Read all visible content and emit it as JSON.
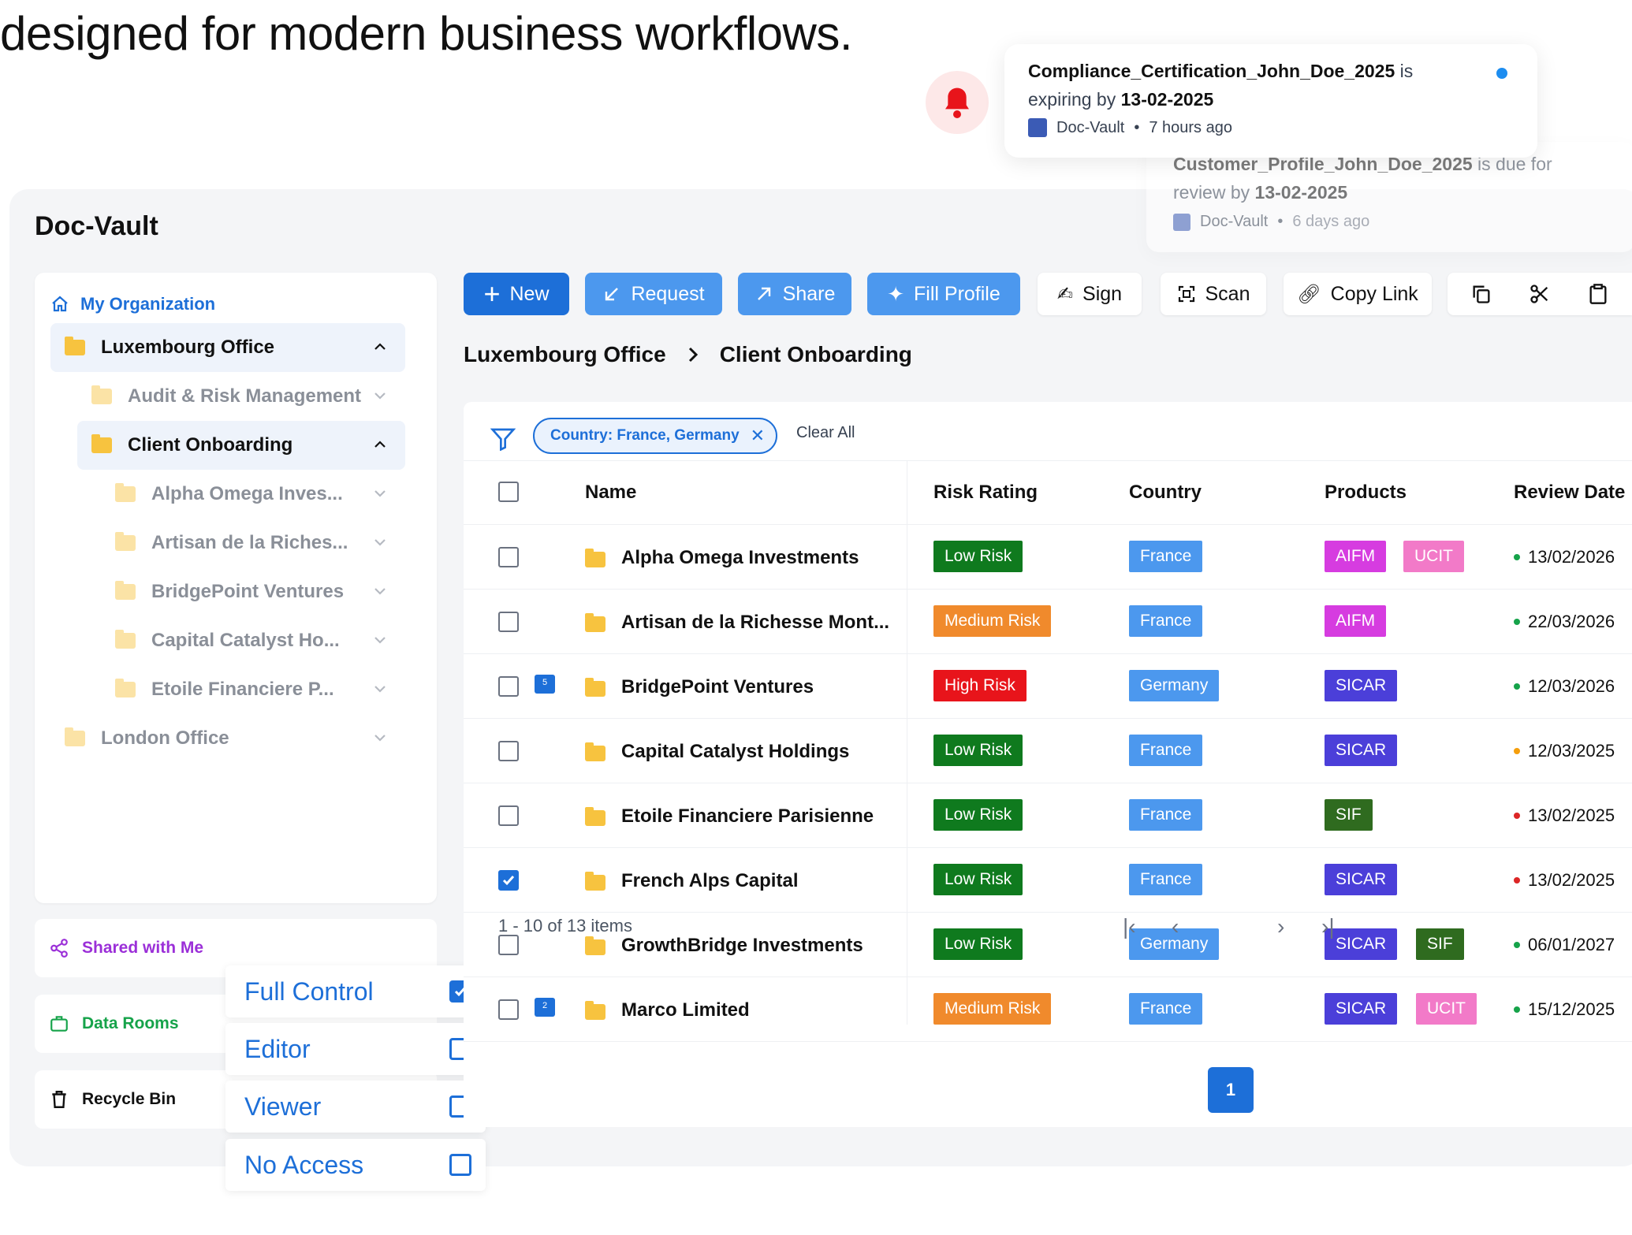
{
  "headline": "designed for modern business workflows.",
  "app": {
    "name": "Doc-Vault"
  },
  "notifications": [
    {
      "file": "Compliance_Certification_John_Doe_2025",
      "mid": " is",
      "line2": "expiring by ",
      "date": "13-02-2025",
      "source": "Doc-Vault",
      "time": "7 hours ago",
      "unread": true
    },
    {
      "file": "Customer_Profile_John_Doe_2025",
      "mid": " is due for",
      "line2": "review by ",
      "date": "13-02-2025",
      "source": "Doc-Vault",
      "time": "6 days ago",
      "unread": false
    }
  ],
  "sidebar": {
    "org": "My Organization",
    "tree": [
      {
        "label": "Luxembourg Office",
        "state": "expanded"
      },
      {
        "label": "Audit & Risk Management",
        "state": "collapsed"
      },
      {
        "label": "Client Onboarding",
        "state": "expanded"
      },
      {
        "label": "Alpha Omega Inves...",
        "state": "collapsed"
      },
      {
        "label": "Artisan de la Riches...",
        "state": "collapsed"
      },
      {
        "label": "BridgePoint Ventures",
        "state": "collapsed"
      },
      {
        "label": "Capital Catalyst Ho...",
        "state": "collapsed"
      },
      {
        "label": "Etoile Financiere P...",
        "state": "collapsed"
      },
      {
        "label": "London Office",
        "state": "collapsed"
      }
    ],
    "shared": "Shared with Me",
    "datarooms": "Data Rooms",
    "recycle": "Recycle Bin"
  },
  "permissions": [
    {
      "label": "Full Control",
      "checked": true
    },
    {
      "label": "Editor",
      "checked": false
    },
    {
      "label": "Viewer",
      "checked": false
    },
    {
      "label": "No Access",
      "checked": false
    }
  ],
  "toolbar": {
    "new": "New",
    "request": "Request",
    "share": "Share",
    "fill": "Fill Profile",
    "sign": "Sign",
    "scan": "Scan",
    "copy": "Copy Link"
  },
  "breadcrumb": [
    "Luxembourg Office",
    "Client Onboarding"
  ],
  "filter": {
    "chip": "Country: France, Germany",
    "clear": "Clear All"
  },
  "table": {
    "headers": {
      "name": "Name",
      "risk": "Risk Rating",
      "country": "Country",
      "products": "Products",
      "review": "Review Date"
    },
    "rows": [
      {
        "name": "Alpha Omega Investments",
        "risk": "Low Risk",
        "country": "France",
        "products": [
          "AIFM",
          "UCIT"
        ],
        "date": "13/02/2026",
        "status": "green",
        "checked": false,
        "comment": ""
      },
      {
        "name": "Artisan de la Richesse Mont...",
        "risk": "Medium Risk",
        "country": "France",
        "products": [
          "AIFM"
        ],
        "date": "22/03/2026",
        "status": "green",
        "checked": false,
        "comment": ""
      },
      {
        "name": "BridgePoint Ventures",
        "risk": "High Risk",
        "country": "Germany",
        "products": [
          "SICAR"
        ],
        "date": "12/03/2026",
        "status": "green",
        "checked": false,
        "comment": "5"
      },
      {
        "name": "Capital Catalyst Holdings",
        "risk": "Low Risk",
        "country": "France",
        "products": [
          "SICAR"
        ],
        "date": "12/03/2025",
        "status": "orange",
        "checked": false,
        "comment": ""
      },
      {
        "name": "Etoile Financiere Parisienne",
        "risk": "Low Risk",
        "country": "France",
        "products": [
          "SIF"
        ],
        "date": "13/02/2025",
        "status": "red",
        "checked": false,
        "comment": ""
      },
      {
        "name": "French Alps Capital",
        "risk": "Low Risk",
        "country": "France",
        "products": [
          "SICAR"
        ],
        "date": "13/02/2025",
        "status": "red",
        "checked": true,
        "comment": ""
      },
      {
        "name": "GrowthBridge Investments",
        "risk": "Low Risk",
        "country": "Germany",
        "products": [
          "SICAR",
          "SIF"
        ],
        "date": "06/01/2027",
        "status": "green",
        "checked": false,
        "comment": ""
      },
      {
        "name": "Marco Limited",
        "risk": "Medium Risk",
        "country": "France",
        "products": [
          "SICAR",
          "UCIT"
        ],
        "date": "15/12/2025",
        "status": "green",
        "checked": false,
        "comment": "2"
      }
    ]
  },
  "pagination": {
    "summary": "1 - 10 of 13 items",
    "page": "1"
  },
  "colors": {
    "primary": "#1d6fd8",
    "risk": {
      "Low Risk": "#0f7a1e",
      "Medium Risk": "#f08a2c",
      "High Risk": "#e8141b"
    },
    "country": "#4c98ee",
    "products": {
      "AIFM": "#d63ce0",
      "UCIT": "#f27ac8",
      "SICAR": "#4b3fd9",
      "SIF": "#2f6b1f"
    },
    "status": {
      "green": "#16a34a",
      "orange": "#f59e0b",
      "red": "#dc2626"
    }
  }
}
